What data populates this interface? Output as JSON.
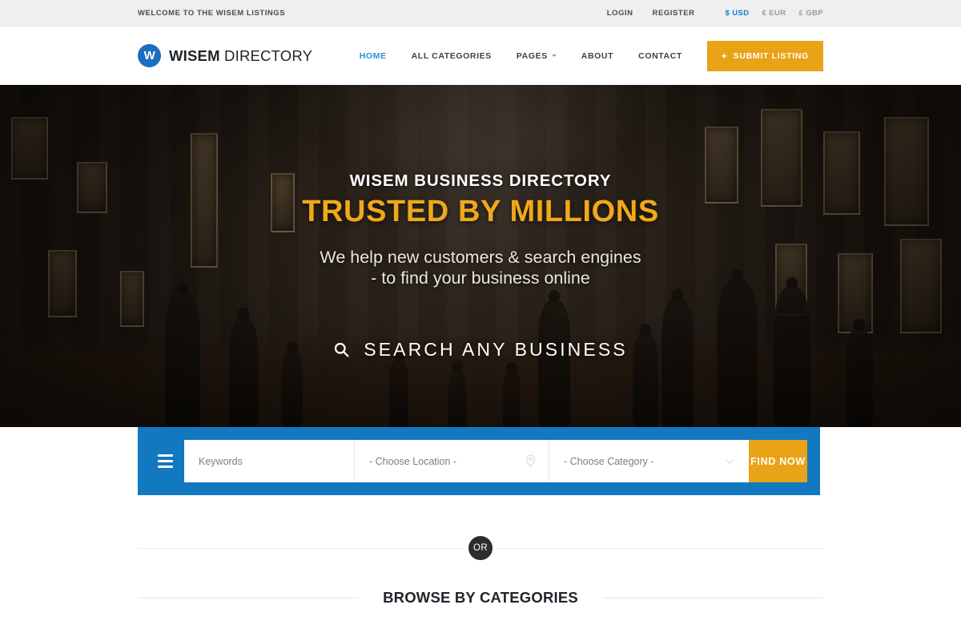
{
  "topbar": {
    "welcome": "WELCOME TO THE WISEM LISTINGS",
    "links": [
      {
        "label": "LOGIN",
        "name": "login"
      },
      {
        "label": "REGISTER",
        "name": "register"
      }
    ],
    "currencies": [
      {
        "label": "$ USD",
        "active": true
      },
      {
        "label": "€ EUR",
        "active": false
      },
      {
        "label": "£ GBP",
        "active": false
      }
    ],
    "accent_active": "#1b7cc2",
    "background": "#efefef"
  },
  "header": {
    "brand": {
      "mark_letter": "W",
      "name_bold": "WISEM",
      "name_light": "DIRECTORY",
      "mark_color": "#1b6fc0"
    },
    "nav": [
      {
        "label": "HOME",
        "active": true,
        "caret": false
      },
      {
        "label": "ALL CATEGORIES",
        "active": false,
        "caret": false
      },
      {
        "label": "PAGES",
        "active": false,
        "caret": true
      },
      {
        "label": "ABOUT",
        "active": false,
        "caret": false
      },
      {
        "label": "CONTACT",
        "active": false,
        "caret": false
      }
    ],
    "submit_button": {
      "plus": "+",
      "label": "SUBMIT LISTING",
      "color": "#e8a317"
    }
  },
  "hero": {
    "eyebrow": "WISEM BUSINESS DIRECTORY",
    "title": "TRUSTED BY MILLIONS",
    "title_color": "#f0a81a",
    "subtitle_line1": "We help new customers & search engines",
    "subtitle_line2": "- to find your business online",
    "search_heading": "SEARCH ANY BUSINESS",
    "search_heading_icon": "search-icon"
  },
  "search_panel": {
    "background": "#1278c0",
    "menu_icon": "hamburger-icon",
    "keywords": {
      "placeholder": "Keywords",
      "value": ""
    },
    "location": {
      "placeholder": "- Choose Location -",
      "icon": "map-pin-icon"
    },
    "category": {
      "placeholder": "- Choose Category -",
      "icon": "chevron-down-icon"
    },
    "find_button": {
      "label": "FIND NOW",
      "color": "#e8a317"
    }
  },
  "divider": {
    "or_label": "OR"
  },
  "categories_section": {
    "heading": "BROWSE BY CATEGORIES"
  }
}
